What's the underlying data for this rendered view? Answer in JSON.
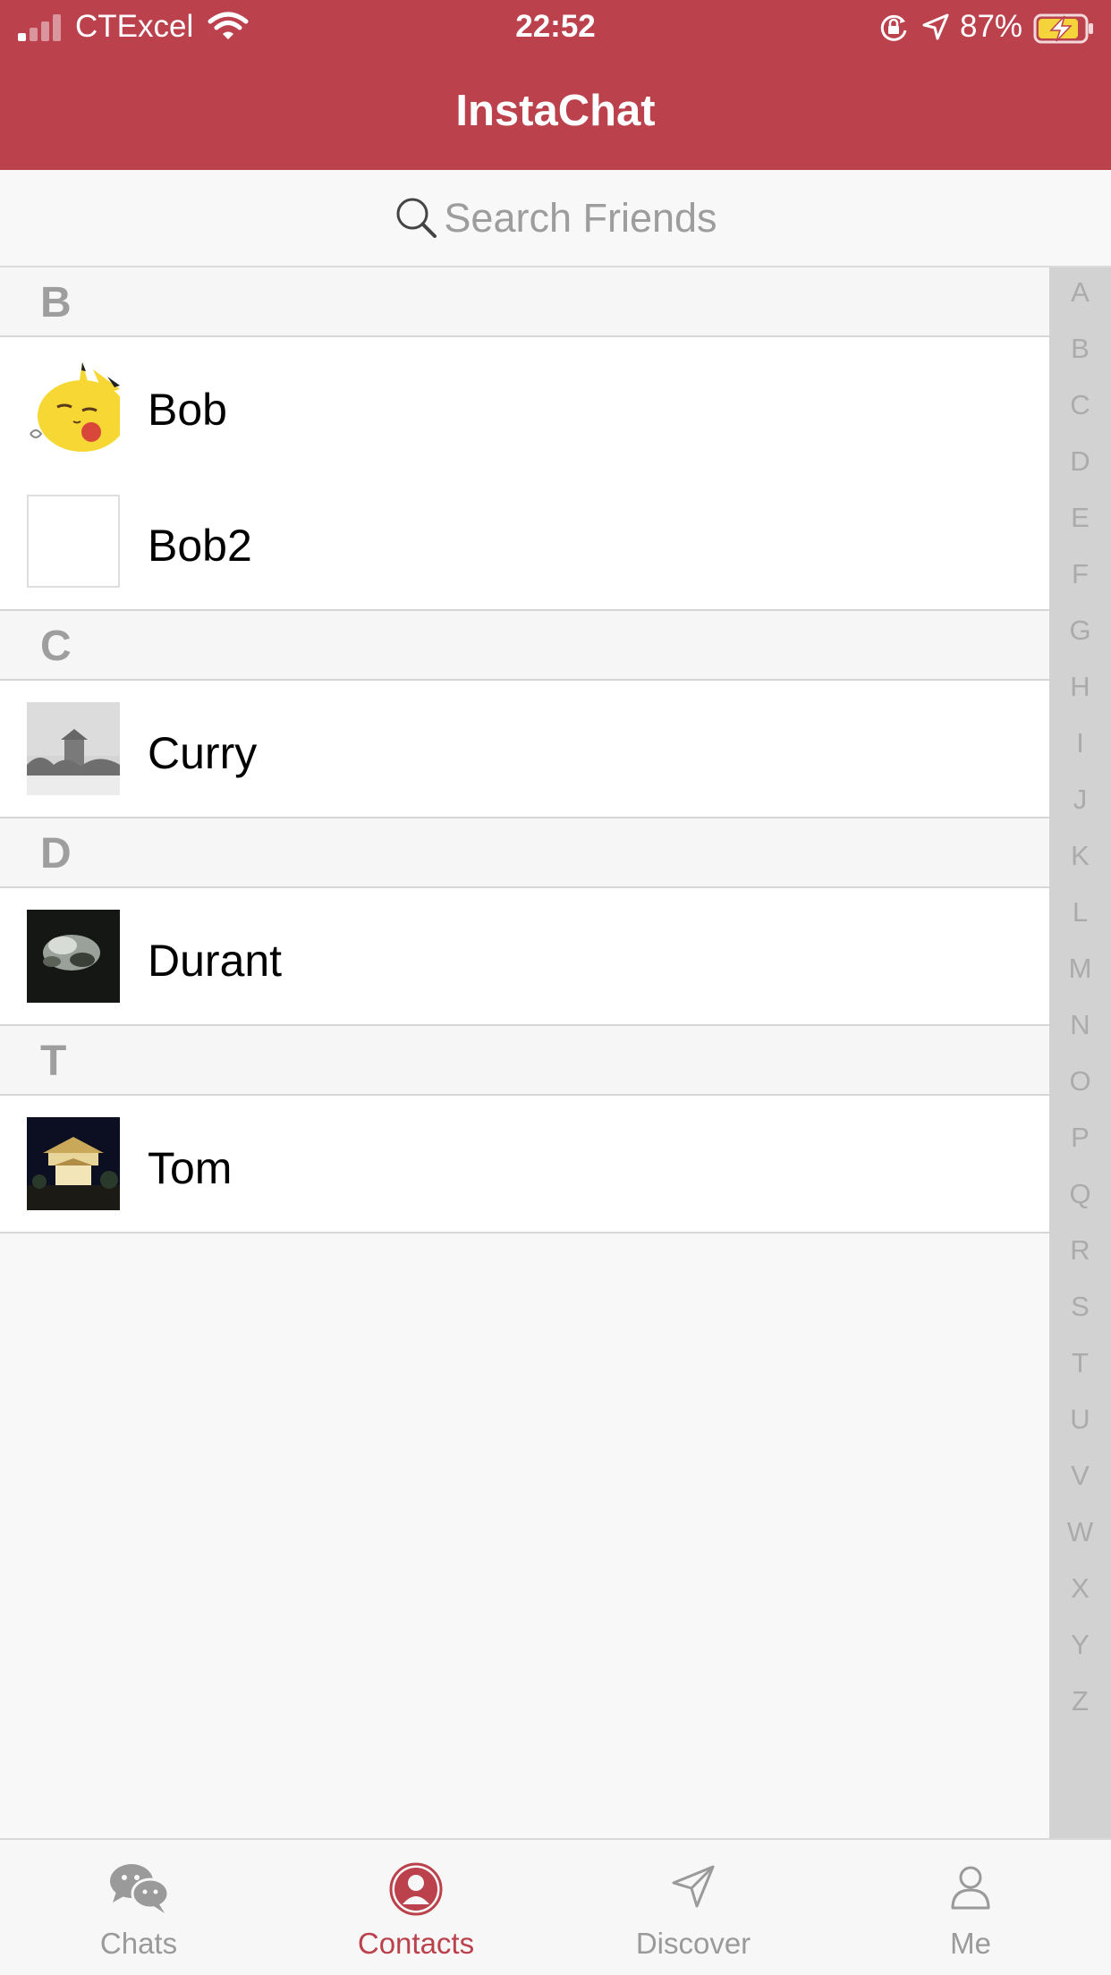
{
  "status_bar": {
    "carrier": "CTExcel",
    "time": "22:52",
    "battery_percent": "87%",
    "signal_bars_active": 1,
    "signal_bars_total": 4
  },
  "nav": {
    "title": "InstaChat"
  },
  "search": {
    "placeholder": "Search Friends",
    "icon": "search-icon"
  },
  "sections": [
    {
      "letter": "B",
      "contacts": [
        {
          "name": "Bob",
          "avatar": "pikachu-avatar"
        },
        {
          "name": "Bob2",
          "avatar": "blank-avatar"
        }
      ]
    },
    {
      "letter": "C",
      "contacts": [
        {
          "name": "Curry",
          "avatar": "snowy-building-avatar"
        }
      ]
    },
    {
      "letter": "D",
      "contacts": [
        {
          "name": "Durant",
          "avatar": "night-clouds-avatar"
        }
      ]
    },
    {
      "letter": "T",
      "contacts": [
        {
          "name": "Tom",
          "avatar": "night-building-avatar"
        }
      ]
    }
  ],
  "index_letters": [
    "A",
    "B",
    "C",
    "D",
    "E",
    "F",
    "G",
    "H",
    "I",
    "J",
    "K",
    "L",
    "M",
    "N",
    "O",
    "P",
    "Q",
    "R",
    "S",
    "T",
    "U",
    "V",
    "W",
    "X",
    "Y",
    "Z"
  ],
  "tabs": [
    {
      "label": "Chats",
      "icon": "chats-icon",
      "active": false
    },
    {
      "label": "Contacts",
      "icon": "contacts-icon",
      "active": true
    },
    {
      "label": "Discover",
      "icon": "discover-icon",
      "active": false
    },
    {
      "label": "Me",
      "icon": "me-icon",
      "active": false
    }
  ],
  "colors": {
    "accent": "#bb414c",
    "inactive": "#9a9a9a",
    "section_letter": "#9e9e9e",
    "index_bar": "#d2d2d2"
  }
}
